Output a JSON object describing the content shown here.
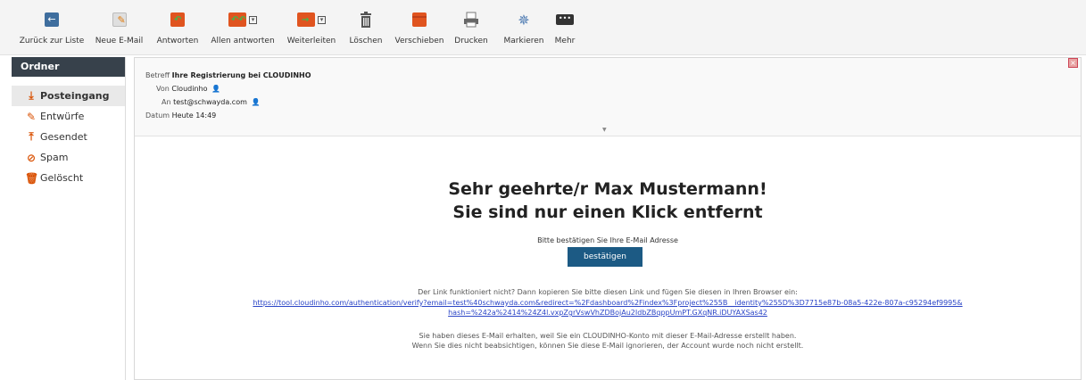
{
  "toolbar": {
    "items": [
      {
        "label": "Zurück zur Liste",
        "icon": "back-arrow-icon"
      },
      {
        "label": "Neue E-Mail",
        "icon": "compose-icon"
      },
      {
        "label": "Antworten",
        "icon": "reply-icon"
      },
      {
        "label": "Allen antworten",
        "icon": "reply-all-icon"
      },
      {
        "label": "Weiterleiten",
        "icon": "forward-icon"
      },
      {
        "label": "Löschen",
        "icon": "trash-icon"
      },
      {
        "label": "Verschieben",
        "icon": "move-icon"
      },
      {
        "label": "Drucken",
        "icon": "print-icon"
      },
      {
        "label": "Markieren",
        "icon": "mark-icon"
      },
      {
        "label": "Mehr",
        "icon": "more-icon"
      }
    ]
  },
  "folders": {
    "title": "Ordner",
    "items": [
      {
        "label": "Posteingang",
        "icon": "inbox-icon",
        "active": true
      },
      {
        "label": "Entwürfe",
        "icon": "pencil-icon"
      },
      {
        "label": "Gesendet",
        "icon": "sent-icon"
      },
      {
        "label": "Spam",
        "icon": "spam-icon"
      },
      {
        "label": "Gelöscht",
        "icon": "trash-icon"
      }
    ]
  },
  "message": {
    "header": {
      "subject_key": "Betreff",
      "subject": "Ihre Registrierung bei CLOUDINHO",
      "from_key": "Von",
      "from": "Cloudinho",
      "to_key": "An",
      "to": "test@schwayda.com",
      "date_key": "Datum",
      "date": "Heute 14:49"
    },
    "body": {
      "greeting": "Sehr geehrte/r Max Mustermann!",
      "headline": "Sie sind nur einen Klick entfernt",
      "instruction": "Bitte bestätigen Sie Ihre E-Mail Adresse",
      "button": "bestätigen",
      "link_hint": "Der Link funktioniert nicht? Dann kopieren Sie bitte diesen Link und fügen Sie diesen in Ihren Browser ein:",
      "link_line1": "https://tool.cloudinho.com/authentication/verify?email=test%40schwayda.com&redirect=%2Fdashboard%2Findex%3Fproject%255B__identity%255D%3D7715e87b-08a5-422e-807a-c95294ef9995&",
      "link_line2": "hash=%242a%2414%24Z4l.vxpZgrVswVhZDBojAu2IdbZBqppUmPT.GXqNR.iDUYAXSas42",
      "footer1": "Sie haben dieses E-Mail erhalten, weil Sie ein CLOUDINHO-Konto mit dieser E-Mail-Adresse erstellt haben.",
      "footer2": "Wenn Sie dies nicht beabsichtigen, können Sie diese E-Mail ignorieren, der Account wurde noch nicht erstellt."
    }
  },
  "colors": {
    "accent_orange": "#e0541f",
    "folder_header": "#37414b",
    "button_blue": "#1c5a84",
    "link_blue": "#2b45c7"
  }
}
